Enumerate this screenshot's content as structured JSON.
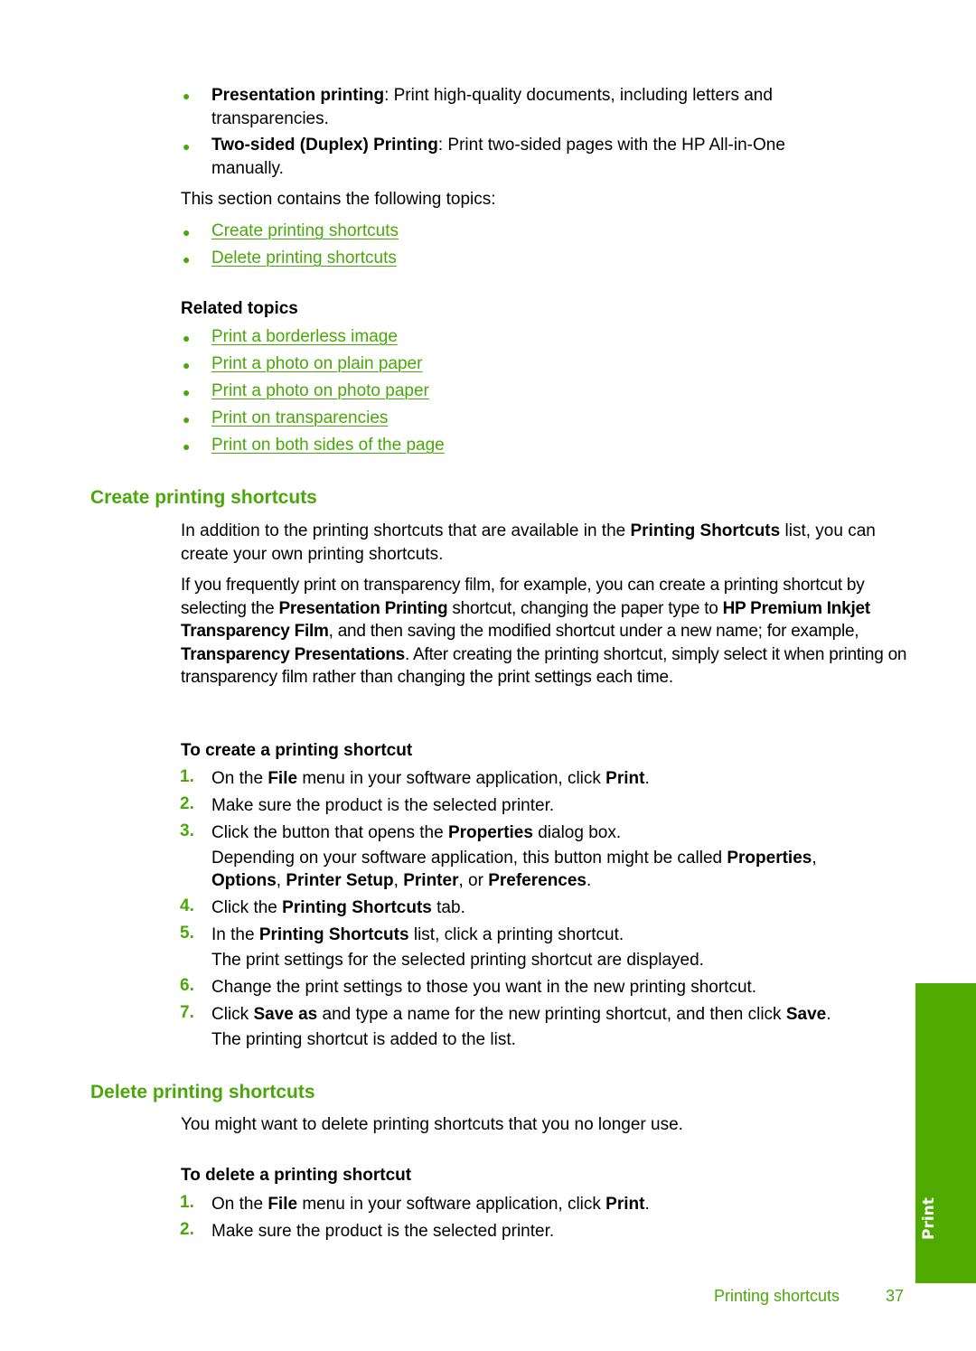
{
  "intro_bullets": [
    {
      "term": "Presentation printing",
      "rest_line1": ": Print high-quality documents, including letters and",
      "rest_line2": "transparencies."
    },
    {
      "term": "Two-sided (Duplex) Printing",
      "rest_line1": ": Print two-sided pages with the HP All-in-One",
      "rest_line2": "manually."
    }
  ],
  "section_intro": "This section contains the following topics:",
  "topic_links": [
    "Create printing shortcuts",
    "Delete printing shortcuts"
  ],
  "related": {
    "heading": "Related topics",
    "links": [
      "Print a borderless image",
      "Print a photo on plain paper",
      "Print a photo on photo paper",
      "Print on transparencies",
      "Print on both sides of the page"
    ]
  },
  "create": {
    "heading": "Create printing shortcuts",
    "p1": {
      "a": "In addition to the printing shortcuts that are available in the ",
      "b1": "Printing Shortcuts",
      "c": " list, you can create your own printing shortcuts."
    },
    "p2": {
      "t1": "If you frequently print on transparency film, for example, you can create a printing shortcut by selecting the ",
      "b1": "Presentation Printing",
      "t2": " shortcut, changing the paper type to ",
      "b2": "HP Premium Inkjet Transparency Film",
      "t3": ", and then saving the modified shortcut under a new name; for example, ",
      "b3": "Transparency Presentations",
      "t4": ". After creating the printing shortcut, simply select it when printing on transparency film rather than changing the print settings each time."
    },
    "procedure_title": "To create a printing shortcut",
    "steps": [
      {
        "num": "1.",
        "t1": "On the ",
        "b1": "File",
        "t2": " menu in your software application, click ",
        "b2": "Print",
        "t3": "."
      },
      {
        "num": "2.",
        "t1": "Make sure the product is the selected printer."
      },
      {
        "num": "3.",
        "t1": "Click the button that opens the ",
        "b1": "Properties",
        "t2": " dialog box.",
        "sub": {
          "t1": "Depending on your software application, this button might be called ",
          "b1": "Properties",
          "t2": ",",
          "b2": "Options",
          "t3": ", ",
          "b3": "Printer Setup",
          "t4": ", ",
          "b4": "Printer",
          "t5": ", or ",
          "b5": "Preferences",
          "t6": "."
        }
      },
      {
        "num": "4.",
        "t1": "Click the ",
        "b1": "Printing Shortcuts",
        "t2": " tab."
      },
      {
        "num": "5.",
        "t1": "In the ",
        "b1": "Printing Shortcuts",
        "t2": " list, click a printing shortcut.",
        "sub": "The print settings for the selected printing shortcut are displayed."
      },
      {
        "num": "6.",
        "t1": "Change the print settings to those you want in the new printing shortcut."
      },
      {
        "num": "7.",
        "t1": "Click ",
        "b1": "Save as",
        "t2": " and type a name for the new printing shortcut, and then click ",
        "b2": "Save",
        "t3": ".",
        "sub": "The printing shortcut is added to the list."
      }
    ]
  },
  "delete": {
    "heading": "Delete printing shortcuts",
    "intro": "You might want to delete printing shortcuts that you no longer use.",
    "procedure_title": "To delete a printing shortcut",
    "steps": [
      {
        "num": "1.",
        "t1": "On the ",
        "b1": "File",
        "t2": " menu in your software application, click ",
        "b2": "Print",
        "t3": "."
      },
      {
        "num": "2.",
        "t1": "Make sure the product is the selected printer."
      }
    ]
  },
  "side_tab": {
    "label": "Print",
    "color": "#4fab00"
  },
  "footer": {
    "section": "Printing shortcuts",
    "page": "37"
  },
  "colors": {
    "accent": "#4aa70a"
  }
}
